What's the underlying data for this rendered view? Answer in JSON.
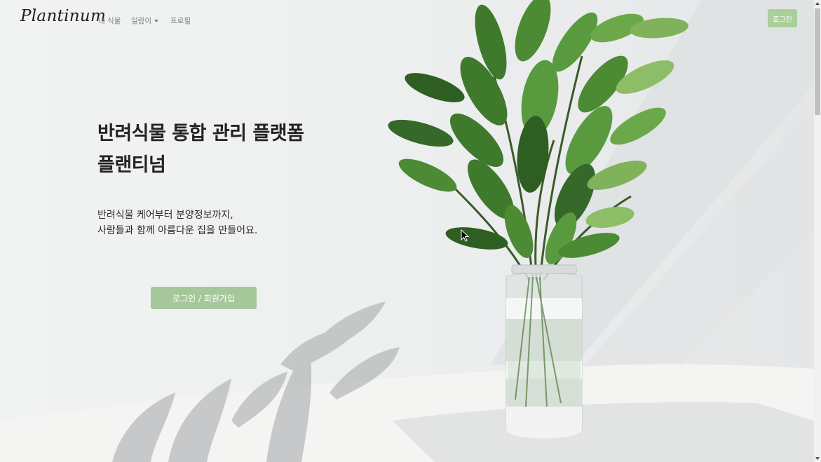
{
  "nav": {
    "brand": "Plantinum",
    "links": [
      {
        "label": "내 식물"
      },
      {
        "label": "일람이"
      },
      {
        "label": "프로필"
      }
    ],
    "login_label": "로그인"
  },
  "hero": {
    "headline_line1": "반려식물 통합 관리 플랫폼",
    "headline_line2": "플랜티넘",
    "sub_line1": "반려식물 케어부터 분양정보까지,",
    "sub_line2": "사람들과 함께 아름다운 집을 만들어요.",
    "cta_label": "로그인 / 회원가입"
  },
  "colors": {
    "accent": "#a9cf9a",
    "leaf_dark": "#2f5e22",
    "leaf_light": "#7fb25b"
  }
}
